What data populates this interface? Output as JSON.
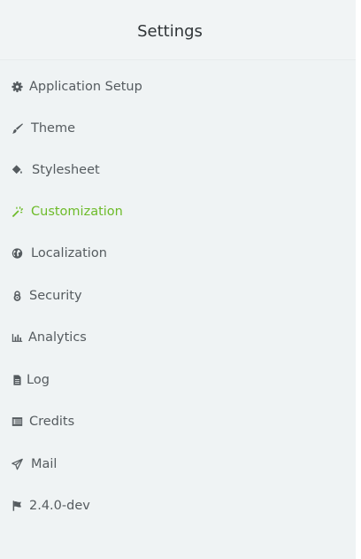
{
  "header": {
    "title": "Settings"
  },
  "colors": {
    "active": "#6dbb29",
    "text": "#555b5f",
    "panel": "#eff3f4"
  },
  "menu": [
    {
      "label": "Application Setup",
      "icon": "gear-icon",
      "active": false
    },
    {
      "label": "Theme",
      "icon": "brush-icon",
      "active": false
    },
    {
      "label": "Stylesheet",
      "icon": "paint-bucket-icon",
      "active": false
    },
    {
      "label": "Customization",
      "icon": "magic-wand-icon",
      "active": true
    },
    {
      "label": "Localization",
      "icon": "globe-icon",
      "active": false
    },
    {
      "label": "Security",
      "icon": "padlock-icon",
      "active": false
    },
    {
      "label": "Analytics",
      "icon": "bar-chart-icon",
      "active": false
    },
    {
      "label": "Log",
      "icon": "file-icon",
      "active": false
    },
    {
      "label": "Credits",
      "icon": "list-icon",
      "active": false
    },
    {
      "label": "Mail",
      "icon": "paper-plane-icon",
      "active": false
    },
    {
      "label": "2.4.0-dev",
      "icon": "flag-icon",
      "active": false
    }
  ]
}
